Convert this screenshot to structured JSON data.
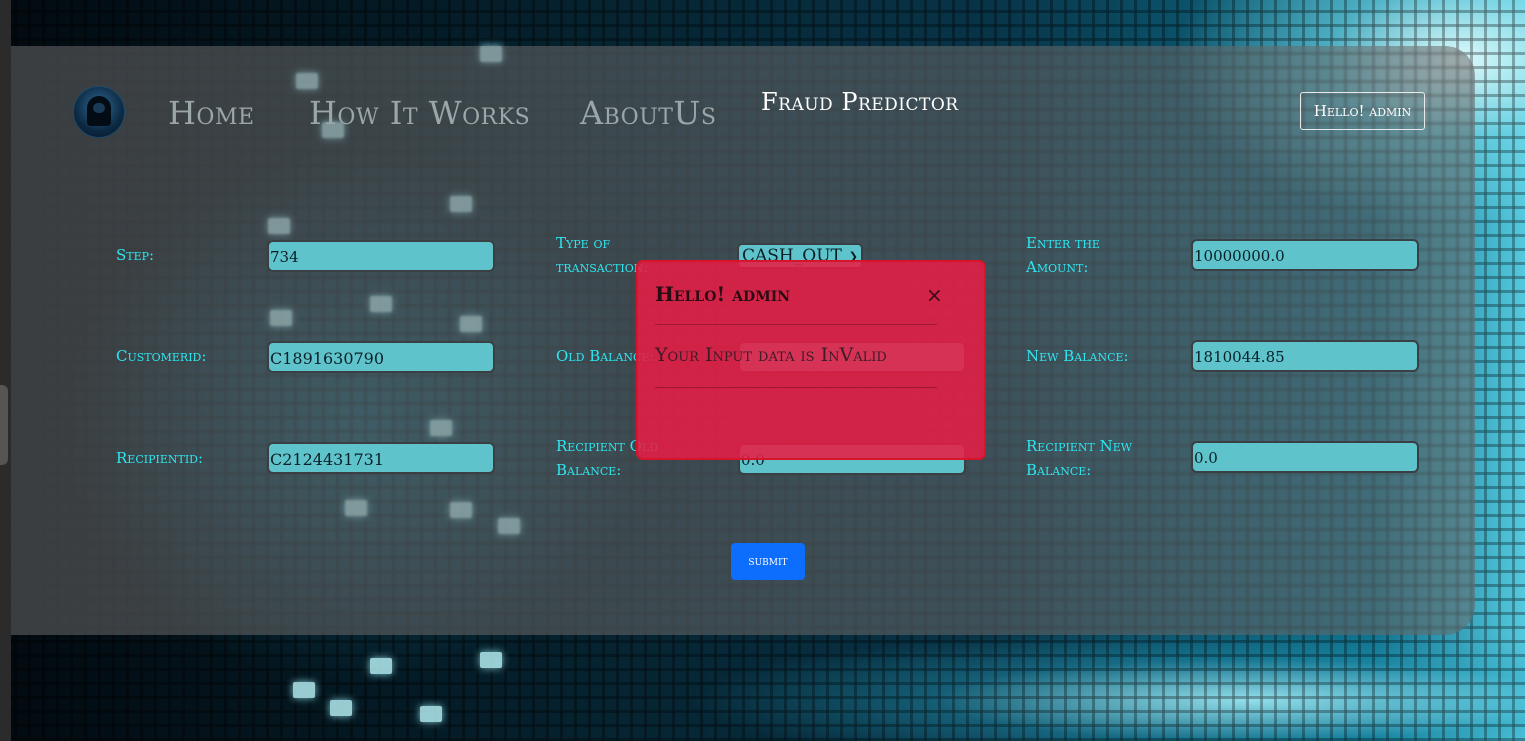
{
  "nav": {
    "home": "Home",
    "how_it_works": "How It Works",
    "about_us": "AboutUs",
    "fraud_predictor": "Fraud Predictor",
    "user_greeting": "Hello! admin"
  },
  "form": {
    "step": {
      "label": "Step:",
      "value": "734"
    },
    "type": {
      "label": "Type of transaction:",
      "value": "CASH_OUT"
    },
    "amount": {
      "label": "Enter the Amount:",
      "value": "10000000.0"
    },
    "customer_id": {
      "label": "Customerid:",
      "value": "C1891630790"
    },
    "old_balance": {
      "label": "Old Balance:",
      "value": ""
    },
    "new_balance": {
      "label": "New Balance:",
      "value": "1810044.85"
    },
    "recipient_id": {
      "label": "Recipientid:",
      "value": "C2124431731"
    },
    "recipient_old_balance": {
      "label": "Recipient Old Balance:",
      "value": "0.0"
    },
    "recipient_new_balance": {
      "label": "Recipient New Balance:",
      "value": "0.0"
    },
    "submit_label": "submit"
  },
  "modal": {
    "title": "Hello! admin",
    "close": "×",
    "message": "Your Input data is InValid"
  },
  "colors": {
    "label": "#2ee6f0",
    "input_bg": "#5fc3cb",
    "submit": "#0d6efd",
    "modal_bg": "#e61e46"
  }
}
